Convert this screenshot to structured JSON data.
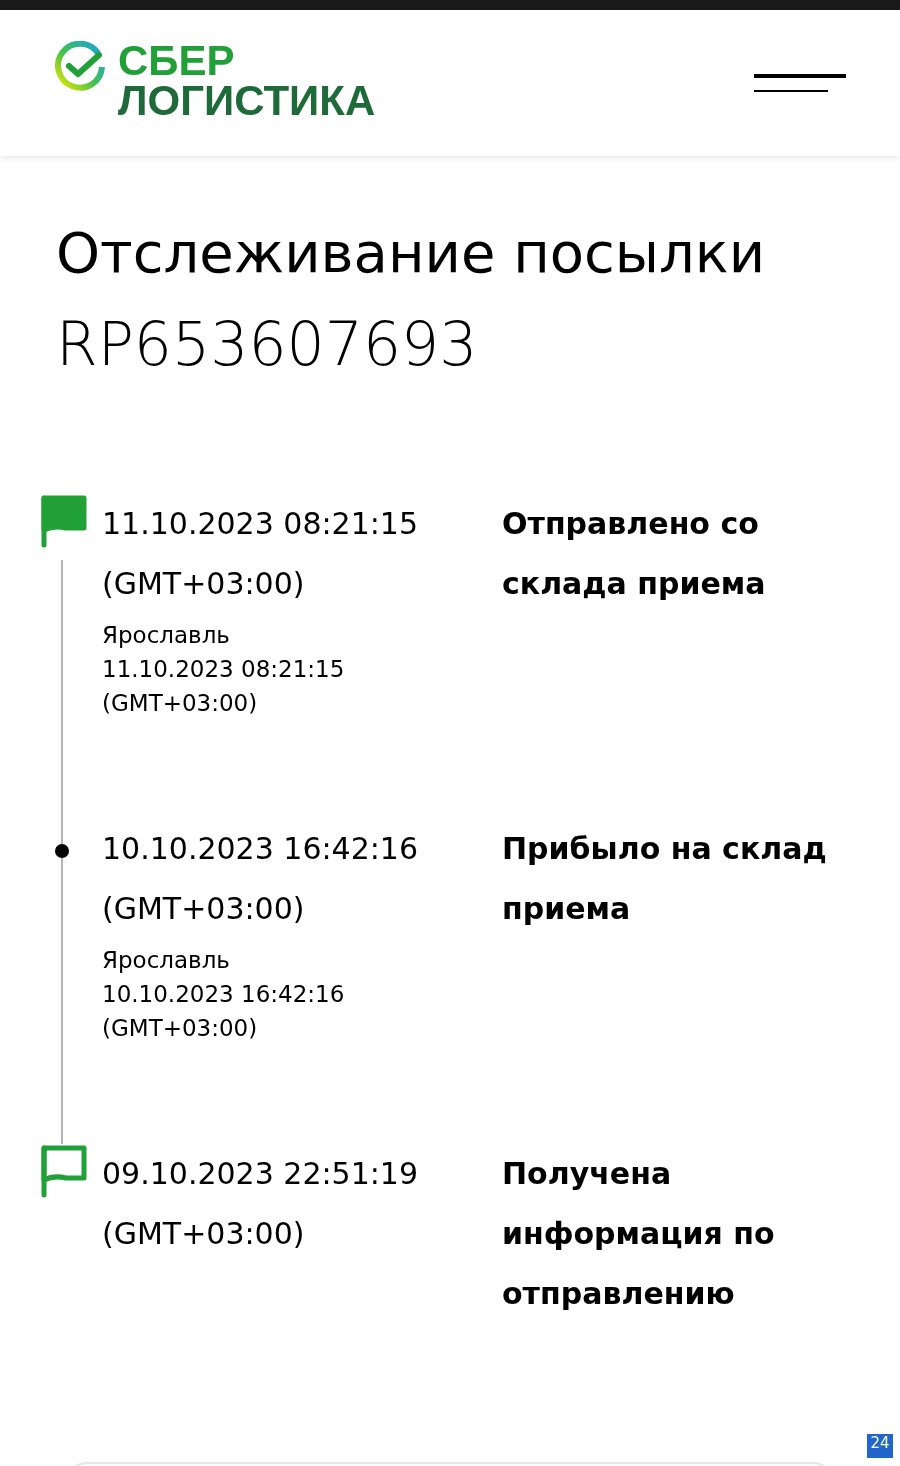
{
  "header": {
    "logo": {
      "line_1": "СБЕР",
      "line_2": "ЛОГИСТИКА"
    }
  },
  "title": "Отслеживание посылки",
  "tracking_number": "RP653607693",
  "events": [
    {
      "kind": "flag-filled",
      "date": "11.10.2023 08:21:15",
      "timezone": "(GMT+03:00)",
      "details": [
        "Ярославль",
        "11.10.2023 08:21:15",
        "(GMT+03:00)"
      ],
      "status": "Отправлено со склада приема"
    },
    {
      "kind": "dot",
      "date": "10.10.2023 16:42:16",
      "timezone": "(GMT+03:00)",
      "details": [
        "Ярославль",
        "10.10.2023 16:42:16",
        "(GMT+03:00)"
      ],
      "status": "Прибыло на склад приема"
    },
    {
      "kind": "flag-outline",
      "date": "09.10.2023 22:51:19",
      "timezone": "(GMT+03:00)",
      "status": "Получена информация по отправлению"
    }
  ],
  "badge": "24"
}
